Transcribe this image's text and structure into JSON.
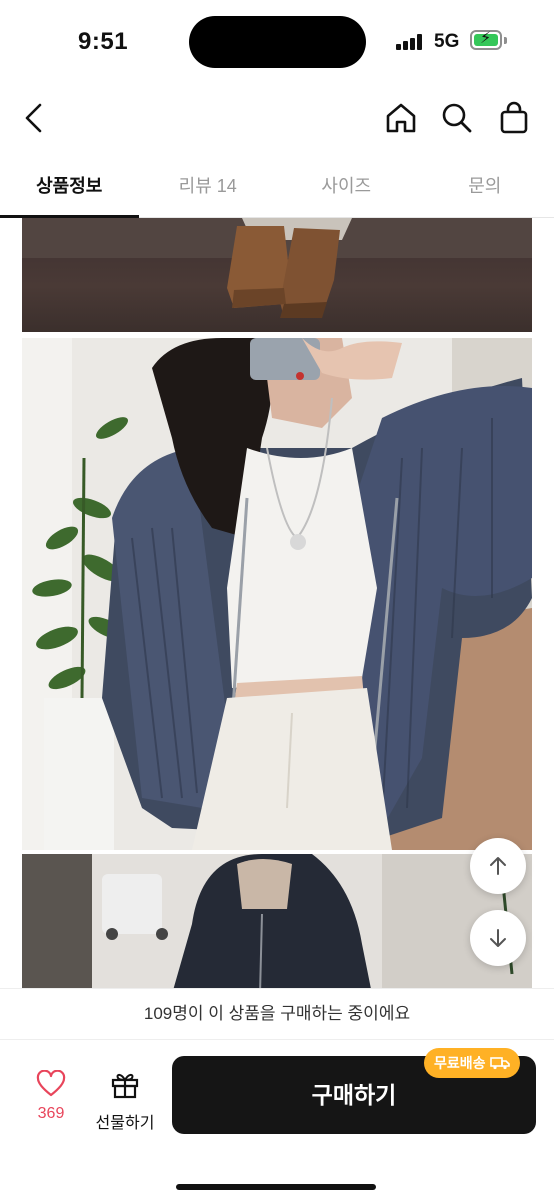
{
  "status": {
    "time": "9:51",
    "network": "5G"
  },
  "nav": {
    "back_icon": "chevron-left-icon",
    "home_icon": "home-icon",
    "search_icon": "search-icon",
    "cart_icon": "shopping-bag-icon"
  },
  "tabs": [
    {
      "label": "상품정보",
      "active": true
    },
    {
      "label": "리뷰 14",
      "active": false
    },
    {
      "label": "사이즈",
      "active": false
    },
    {
      "label": "문의",
      "active": false
    }
  ],
  "scroll": {
    "up_icon": "arrow-up-icon",
    "down_icon": "arrow-down-icon"
  },
  "notice": {
    "text": "109명이 이 상품을 구매하는 중이에요"
  },
  "bottom": {
    "like_count": "369",
    "gift_label": "선물하기",
    "buy_label": "구매하기",
    "free_shipping_label": "무료배송"
  },
  "colors": {
    "accent_like": "#e8455b",
    "badge": "#ffb125",
    "buy_button": "#151515"
  }
}
